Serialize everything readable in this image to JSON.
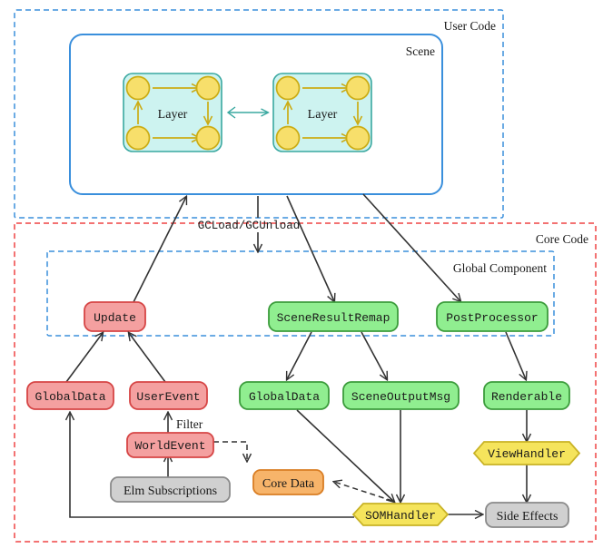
{
  "diagram": {
    "title_hidden": "",
    "groups": [
      {
        "id": "user_code",
        "label": "User Code",
        "style": "dashed-blue"
      },
      {
        "id": "scene",
        "label": "Scene",
        "style": "solid-blue"
      },
      {
        "id": "core_code",
        "label": "Core Code",
        "style": "dashed-red"
      },
      {
        "id": "global_component",
        "label": "Global Component",
        "style": "dashed-blue"
      }
    ],
    "layers": [
      {
        "id": "layer_left",
        "label": "Layer"
      },
      {
        "id": "layer_right",
        "label": "Layer"
      }
    ],
    "nodes": [
      {
        "id": "update",
        "label": "Update",
        "color": "red",
        "shape": "rounded-rect"
      },
      {
        "id": "scene_result_remap",
        "label": "SceneResultRemap",
        "color": "green",
        "shape": "rounded-rect"
      },
      {
        "id": "post_processor",
        "label": "PostProcessor",
        "color": "green",
        "shape": "rounded-rect"
      },
      {
        "id": "global_data_red",
        "label": "GlobalData",
        "color": "red",
        "shape": "rounded-rect"
      },
      {
        "id": "user_event",
        "label": "UserEvent",
        "color": "red",
        "shape": "rounded-rect"
      },
      {
        "id": "global_data_green",
        "label": "GlobalData",
        "color": "green",
        "shape": "rounded-rect"
      },
      {
        "id": "scene_output_msg",
        "label": "SceneOutputMsg",
        "color": "green",
        "shape": "rounded-rect"
      },
      {
        "id": "renderable",
        "label": "Renderable",
        "color": "green",
        "shape": "rounded-rect"
      },
      {
        "id": "world_event",
        "label": "WorldEvent",
        "color": "red",
        "shape": "rounded-rect"
      },
      {
        "id": "elm_subscriptions",
        "label": "Elm Subscriptions",
        "color": "grey",
        "shape": "rounded-rect"
      },
      {
        "id": "core_data",
        "label": "Core Data",
        "color": "orange",
        "shape": "rounded-rect"
      },
      {
        "id": "view_handler",
        "label": "ViewHandler",
        "color": "yellow",
        "shape": "hexagon"
      },
      {
        "id": "som_handler",
        "label": "SOMHandler",
        "color": "yellow",
        "shape": "hexagon"
      },
      {
        "id": "side_effects",
        "label": "Side Effects",
        "color": "grey",
        "shape": "rounded-rect"
      }
    ],
    "edge_labels": [
      {
        "id": "gcload",
        "label": "GCLoad/GCUnload"
      },
      {
        "id": "filter",
        "label": "Filter"
      }
    ],
    "colors": {
      "red_fill": "#f4a0a0",
      "red_stroke": "#d64545",
      "green_fill": "#90ee90",
      "green_stroke": "#3c9c3c",
      "yellow_fill": "#f5e45c",
      "yellow_stroke": "#c9b326",
      "orange_fill": "#f7b46a",
      "orange_stroke": "#d97d23",
      "grey_fill": "#d0d0d0",
      "grey_stroke": "#8a8a8a",
      "cyan_fill": "#cdf3f0",
      "cyan_stroke": "#3aa8a0",
      "gold": "#cbac14",
      "blue": "#3a8fdc",
      "red_dash": "#ef4444",
      "arrow": "#333333"
    }
  }
}
